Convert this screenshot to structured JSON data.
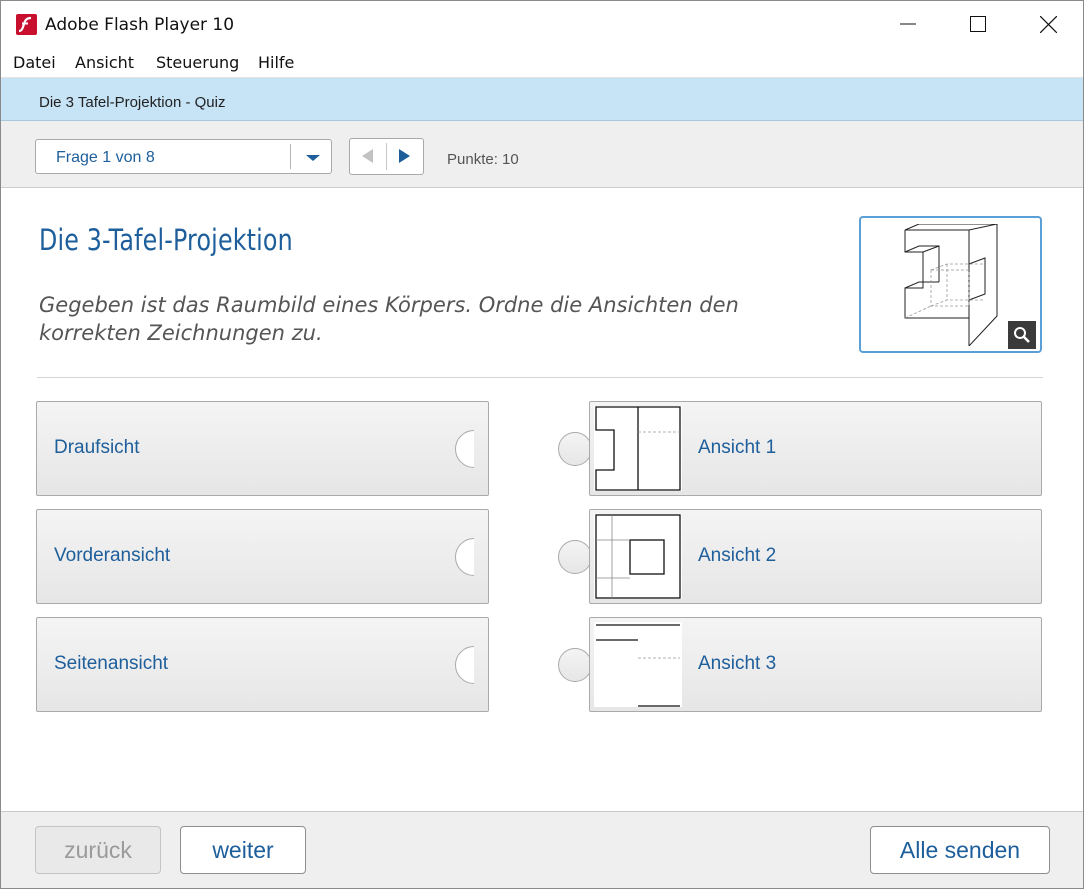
{
  "window": {
    "title": "Adobe Flash Player 10"
  },
  "menu": {
    "items": [
      "Datei",
      "Ansicht",
      "Steuerung",
      "Hilfe"
    ]
  },
  "quiz": {
    "title": "Die 3 Tafel-Projektion - Quiz",
    "question_select": "Frage 1 von 8",
    "score": "Punkte: 10",
    "heading": "Die 3-Tafel-Projektion",
    "instruction": "Gegeben ist das Raumbild eines Körpers. Ordne die Ansichten den korrekten Zeichnungen zu.",
    "left_items": [
      "Draufsicht",
      "Vorderansicht",
      "Seitenansicht"
    ],
    "right_items": [
      "Ansicht 1",
      "Ansicht 2",
      "Ansicht 3"
    ]
  },
  "footer": {
    "back_label": "zurück",
    "next_label": "weiter",
    "send_label": "Alle senden"
  },
  "colors": {
    "accent": "#1d5e9b",
    "quizbar": "#c7e3f6",
    "flash_red": "#c8102e"
  }
}
